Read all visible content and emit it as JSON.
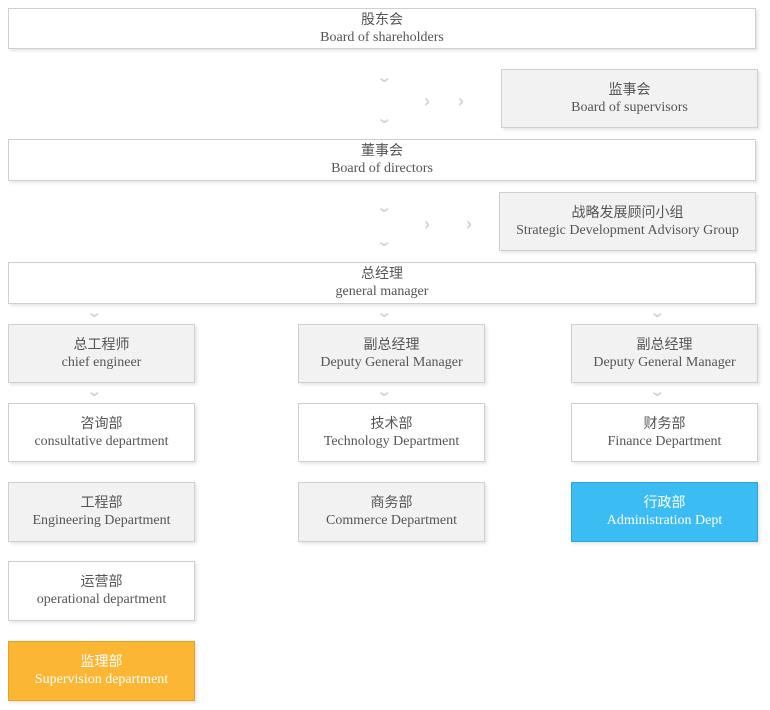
{
  "nodes": {
    "shareholders": {
      "zh": "股东会",
      "en": "Board of shareholders"
    },
    "supervisors": {
      "zh": "监事会",
      "en": "Board of supervisors"
    },
    "directors": {
      "zh": "董事会",
      "en": "Board of directors"
    },
    "strategy_group": {
      "zh": "战略发展顾问小组",
      "en": "Strategic Development Advisory Group"
    },
    "general_manager": {
      "zh": "总经理",
      "en": "general manager"
    },
    "chief_engineer": {
      "zh": "总工程师",
      "en": "chief engineer"
    },
    "deputy_gm_1": {
      "zh": "副总经理",
      "en": "Deputy General Manager"
    },
    "deputy_gm_2": {
      "zh": "副总经理",
      "en": "Deputy General Manager"
    },
    "consultative": {
      "zh": "咨询部",
      "en": "consultative department"
    },
    "technology": {
      "zh": "技术部",
      "en": "Technology Department"
    },
    "finance": {
      "zh": "财务部",
      "en": "Finance Department"
    },
    "engineering": {
      "zh": "工程部",
      "en": "Engineering Department"
    },
    "commerce": {
      "zh": "商务部",
      "en": "Commerce Department"
    },
    "administration": {
      "zh": "行政部",
      "en": "Administration Dept"
    },
    "operational": {
      "zh": "运营部",
      "en": "operational department"
    },
    "supervision": {
      "zh": "监理部",
      "en": "Supervision department"
    }
  },
  "colors": {
    "highlight_blue": "#3bbcf2",
    "highlight_orange": "#fbb633",
    "box_gray": "#f2f2f2",
    "connector": "#d2d2d2"
  },
  "icons": {
    "down": "chevron-down-icon",
    "right": "chevron-right-icon"
  }
}
